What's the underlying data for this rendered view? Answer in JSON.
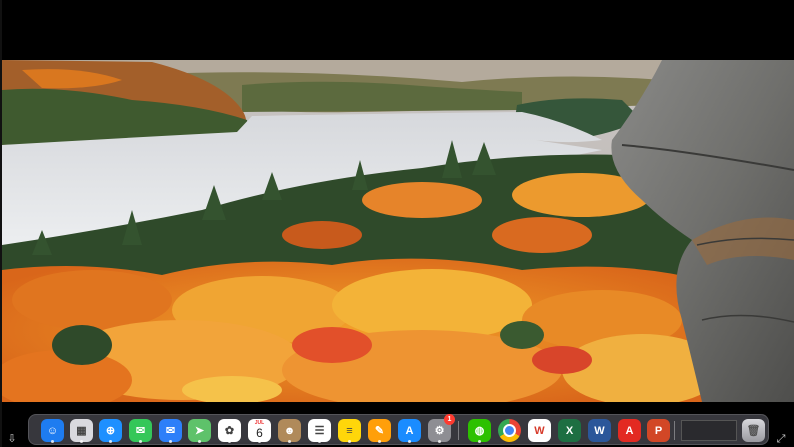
{
  "video": {
    "description_icon": "autumn-lake-landscape"
  },
  "dock": {
    "apps": [
      {
        "name": "finder",
        "icon": "finder-icon",
        "color": "#1e7cf0"
      },
      {
        "name": "launchpad",
        "icon": "launchpad-icon",
        "color": "#d9d9de"
      },
      {
        "name": "safari",
        "icon": "safari-icon",
        "color": "#1e90ff"
      },
      {
        "name": "messages",
        "icon": "messages-icon",
        "color": "#34c759"
      },
      {
        "name": "mail",
        "icon": "mail-icon",
        "color": "#2d7ff9"
      },
      {
        "name": "maps",
        "icon": "maps-icon",
        "color": "#5ec26a"
      },
      {
        "name": "photos",
        "icon": "photos-icon",
        "color": "#ffffff"
      },
      {
        "name": "calendar",
        "icon": "calendar-icon",
        "color": "#ffffff",
        "month": "JUL",
        "day": "6"
      },
      {
        "name": "contacts",
        "icon": "contacts-icon",
        "color": "#b08a5a"
      },
      {
        "name": "reminders",
        "icon": "reminders-icon",
        "color": "#ffffff"
      },
      {
        "name": "notes",
        "icon": "notes-icon",
        "color": "#ffd60a"
      },
      {
        "name": "pages",
        "icon": "pages-icon",
        "color": "#ff9f0a"
      },
      {
        "name": "app-store",
        "icon": "app-store-icon",
        "color": "#1a8cff"
      },
      {
        "name": "system-settings",
        "icon": "settings-icon",
        "color": "#8e8e93",
        "badge": "1"
      },
      {
        "name": "wechat",
        "icon": "wechat-icon",
        "color": "#2dc100"
      },
      {
        "name": "chrome",
        "icon": "chrome-icon",
        "color": "#ffffff"
      },
      {
        "name": "wps",
        "icon": "wps-icon",
        "color": "#ffffff"
      },
      {
        "name": "excel",
        "icon": "excel-icon",
        "color": "#1d6f42"
      },
      {
        "name": "word",
        "icon": "word-icon",
        "color": "#2b579a"
      },
      {
        "name": "acrobat",
        "icon": "acrobat-icon",
        "color": "#e32a22"
      },
      {
        "name": "powerpoint",
        "icon": "powerpoint-icon",
        "color": "#d24726"
      }
    ],
    "trash": {
      "icon": "trash-icon"
    }
  }
}
